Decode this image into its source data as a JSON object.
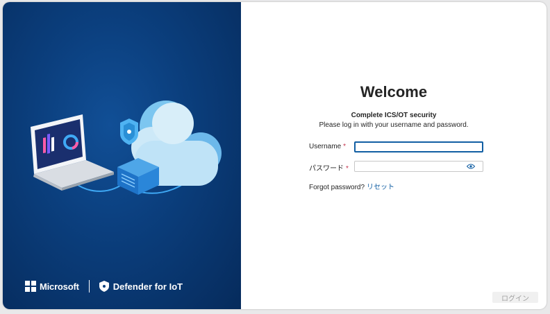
{
  "hero": {
    "brand_microsoft": "Microsoft",
    "brand_product": "Defender for IoT"
  },
  "form": {
    "title": "Welcome",
    "subtitle": "Complete ICS/OT security",
    "instructions": "Please log in with your username and password.",
    "username_label": "Username",
    "username_value": "",
    "password_label": "パスワード",
    "password_value": "",
    "required_mark": "*",
    "forgot_text": "Forgot password?",
    "reset_link": "リセット",
    "login_button": "ログイン"
  },
  "colors": {
    "hero_dark": "#062b5c",
    "hero_mid": "#114f96",
    "accent": "#115ea3",
    "required": "#c4314b"
  },
  "icons": [
    "microsoft-logo-icon",
    "defender-shield-icon",
    "show-password-icon"
  ]
}
